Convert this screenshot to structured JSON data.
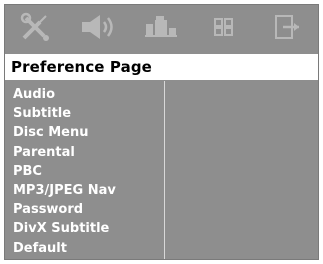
{
  "toolbar": {
    "icons": [
      "settings-tools-icon",
      "speaker-icon",
      "video-icon",
      "preference-icon",
      "exit-icon"
    ]
  },
  "header": {
    "title": "Preference Page"
  },
  "menu": {
    "items": [
      {
        "label": "Audio"
      },
      {
        "label": "Subtitle"
      },
      {
        "label": "Disc Menu"
      },
      {
        "label": "Parental"
      },
      {
        "label": "PBC"
      },
      {
        "label": "MP3/JPEG Nav"
      },
      {
        "label": "Password"
      },
      {
        "label": "DivX Subtitle"
      },
      {
        "label": "Default"
      }
    ]
  },
  "colors": {
    "background": "#8e8e8e",
    "title_bar": "#ffffff",
    "text": "#ffffff",
    "title_text": "#000000"
  }
}
